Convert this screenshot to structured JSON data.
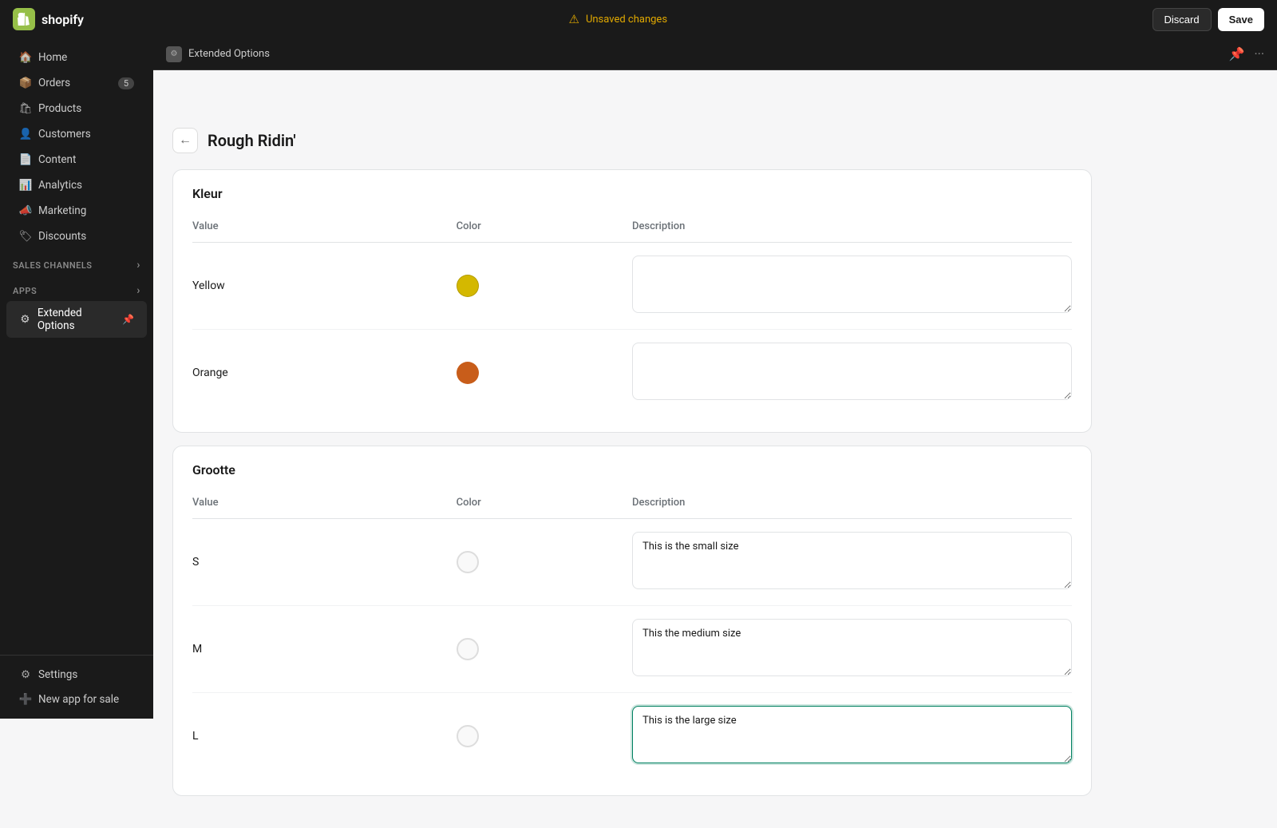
{
  "topbar": {
    "logo": "shopify",
    "logo_letter": "S",
    "unsaved_label": "Unsaved changes",
    "discard_label": "Discard",
    "save_label": "Save"
  },
  "sidebar": {
    "nav_items": [
      {
        "id": "home",
        "label": "Home",
        "icon": "🏠",
        "badge": null
      },
      {
        "id": "orders",
        "label": "Orders",
        "icon": "📦",
        "badge": "5"
      },
      {
        "id": "products",
        "label": "Products",
        "icon": "🛍",
        "badge": null
      },
      {
        "id": "customers",
        "label": "Customers",
        "icon": "👤",
        "badge": null
      },
      {
        "id": "content",
        "label": "Content",
        "icon": "📄",
        "badge": null
      },
      {
        "id": "analytics",
        "label": "Analytics",
        "icon": "📊",
        "badge": null
      },
      {
        "id": "marketing",
        "label": "Marketing",
        "icon": "📣",
        "badge": null
      },
      {
        "id": "discounts",
        "label": "Discounts",
        "icon": "🏷",
        "badge": null
      }
    ],
    "sales_channels_label": "Sales channels",
    "apps_label": "Apps",
    "extended_options_label": "Extended Options",
    "settings_label": "Settings",
    "new_app_label": "New app for sale"
  },
  "subheader": {
    "title": "Extended Options"
  },
  "page": {
    "back_icon": "←",
    "title": "Rough Ridin'",
    "sections": [
      {
        "id": "kleur",
        "title": "Kleur",
        "columns": {
          "value": "Value",
          "color": "Color",
          "description": "Description"
        },
        "rows": [
          {
            "value": "Yellow",
            "color_hex": "#d4b800",
            "color_style": "background:#d4b800;box-shadow:inset 0 0 0 2px rgba(0,0,0,0.1)",
            "description": ""
          },
          {
            "value": "Orange",
            "color_hex": "#c85d1a",
            "color_style": "background:#c85d1a",
            "description": ""
          }
        ]
      },
      {
        "id": "grootte",
        "title": "Grootte",
        "columns": {
          "value": "Value",
          "color": "Color",
          "description": "Description"
        },
        "rows": [
          {
            "value": "S",
            "color_hex": "",
            "description": "This is the small size",
            "focused": false
          },
          {
            "value": "M",
            "color_hex": "",
            "description": "This the medium size",
            "focused": false
          },
          {
            "value": "L",
            "color_hex": "",
            "description": "This is the large size",
            "focused": true
          }
        ]
      }
    ]
  }
}
